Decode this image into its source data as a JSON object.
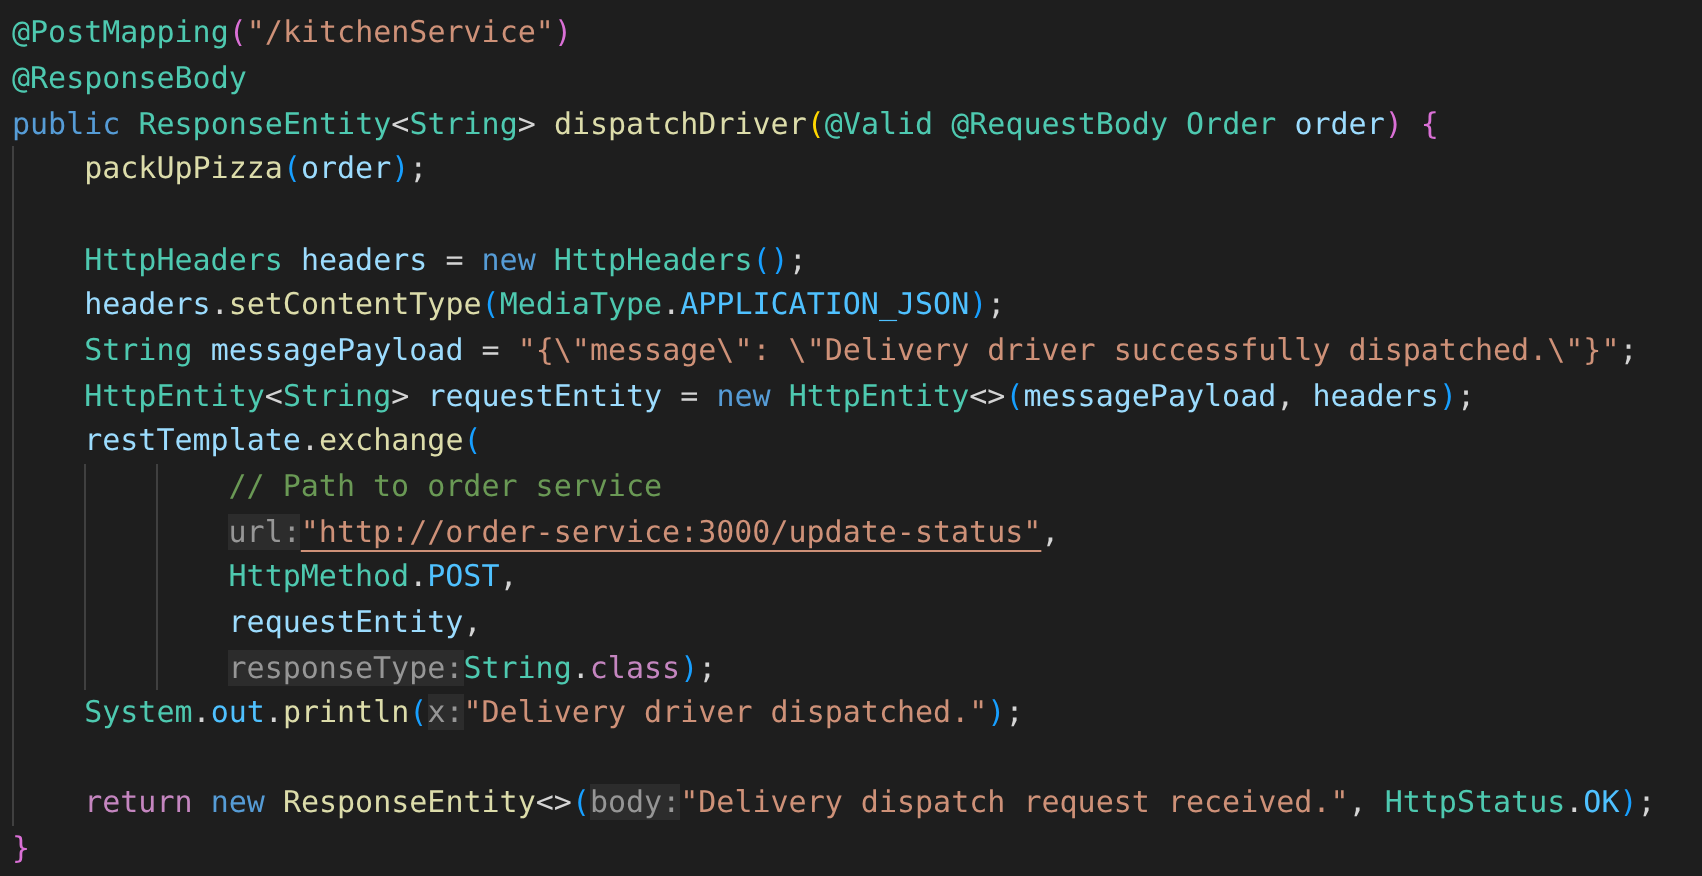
{
  "editor": {
    "lines": [
      {
        "tokens": [
          {
            "kind": "ann",
            "text": "@PostMapping"
          },
          {
            "kind": "b2",
            "text": "("
          },
          {
            "kind": "str",
            "text": "\"/kitchenService\""
          },
          {
            "kind": "b2",
            "text": ")"
          }
        ]
      },
      {
        "tokens": [
          {
            "kind": "ann",
            "text": "@ResponseBody"
          }
        ]
      },
      {
        "tokens": [
          {
            "kind": "kw",
            "text": "public "
          },
          {
            "kind": "type",
            "text": "ResponseEntity"
          },
          {
            "kind": "plain",
            "text": "<"
          },
          {
            "kind": "type",
            "text": "String"
          },
          {
            "kind": "plain",
            "text": "> "
          },
          {
            "kind": "fn",
            "text": "dispatchDriver"
          },
          {
            "kind": "b1",
            "text": "("
          },
          {
            "kind": "ann",
            "text": "@Valid @RequestBody Order "
          },
          {
            "kind": "var",
            "text": "order"
          },
          {
            "kind": "b2",
            "text": ")"
          },
          {
            "kind": "b2",
            "text": " {"
          }
        ],
        "children": [
          {
            "tokens": [
              {
                "kind": "fn",
                "text": "packUpPizza"
              },
              {
                "kind": "b3",
                "text": "("
              },
              {
                "kind": "var",
                "text": "order"
              },
              {
                "kind": "b3",
                "text": ")"
              },
              {
                "kind": "plain",
                "text": ";"
              }
            ]
          },
          {
            "kind": "blank"
          },
          {
            "tokens": [
              {
                "kind": "type",
                "text": "HttpHeaders "
              },
              {
                "kind": "var",
                "text": "headers"
              },
              {
                "kind": "plain",
                "text": " = "
              },
              {
                "kind": "kw",
                "text": "new "
              },
              {
                "kind": "type",
                "text": "HttpHeaders"
              },
              {
                "kind": "b3",
                "text": "()"
              },
              {
                "kind": "plain",
                "text": ";"
              }
            ]
          },
          {
            "tokens": [
              {
                "kind": "var",
                "text": "headers"
              },
              {
                "kind": "plain",
                "text": "."
              },
              {
                "kind": "fn",
                "text": "setContentType"
              },
              {
                "kind": "b3",
                "text": "("
              },
              {
                "kind": "type",
                "text": "MediaType"
              },
              {
                "kind": "plain",
                "text": "."
              },
              {
                "kind": "const",
                "text": "APPLICATION_JSON"
              },
              {
                "kind": "b3",
                "text": ")"
              },
              {
                "kind": "plain",
                "text": ";"
              }
            ]
          },
          {
            "tokens": [
              {
                "kind": "type",
                "text": "String "
              },
              {
                "kind": "var",
                "text": "messagePayload"
              },
              {
                "kind": "plain",
                "text": " = "
              },
              {
                "kind": "str",
                "text": "\"{\\\"message\\\": \\\"Delivery driver successfully dispatched.\\\"}\""
              },
              {
                "kind": "plain",
                "text": ";"
              }
            ]
          },
          {
            "tokens": [
              {
                "kind": "type",
                "text": "HttpEntity"
              },
              {
                "kind": "plain",
                "text": "<"
              },
              {
                "kind": "type",
                "text": "String"
              },
              {
                "kind": "plain",
                "text": "> "
              },
              {
                "kind": "var",
                "text": "requestEntity"
              },
              {
                "kind": "plain",
                "text": " = "
              },
              {
                "kind": "kw",
                "text": "new "
              },
              {
                "kind": "type",
                "text": "HttpEntity"
              },
              {
                "kind": "plain",
                "text": "<>"
              },
              {
                "kind": "b3",
                "text": "("
              },
              {
                "kind": "var",
                "text": "messagePayload"
              },
              {
                "kind": "plain",
                "text": ", "
              },
              {
                "kind": "var",
                "text": "headers"
              },
              {
                "kind": "b3",
                "text": ")"
              },
              {
                "kind": "plain",
                "text": ";"
              }
            ]
          },
          {
            "tokens": [
              {
                "kind": "var",
                "text": "restTemplate"
              },
              {
                "kind": "plain",
                "text": "."
              },
              {
                "kind": "fn",
                "text": "exchange"
              },
              {
                "kind": "b3",
                "text": "("
              }
            ],
            "hanging": true,
            "children": [
              {
                "tokens": [
                  {
                    "kind": "com",
                    "text": "// Path to order service"
                  }
                ]
              },
              {
                "tokens": [
                  {
                    "kind": "hint",
                    "text": "url:"
                  },
                  {
                    "kind": "url",
                    "text": "\"http://order-service:3000/update-status\""
                  },
                  {
                    "kind": "plain",
                    "text": ","
                  }
                ]
              },
              {
                "tokens": [
                  {
                    "kind": "type",
                    "text": "HttpMethod"
                  },
                  {
                    "kind": "plain",
                    "text": "."
                  },
                  {
                    "kind": "const",
                    "text": "POST"
                  },
                  {
                    "kind": "plain",
                    "text": ","
                  }
                ]
              },
              {
                "tokens": [
                  {
                    "kind": "var",
                    "text": "requestEntity"
                  },
                  {
                    "kind": "plain",
                    "text": ","
                  }
                ]
              },
              {
                "tokens": [
                  {
                    "kind": "hint",
                    "text": "responseType:"
                  },
                  {
                    "kind": "type",
                    "text": "String"
                  },
                  {
                    "kind": "plain",
                    "text": "."
                  },
                  {
                    "kind": "ctl",
                    "text": "class"
                  },
                  {
                    "kind": "b3",
                    "text": ")"
                  },
                  {
                    "kind": "plain",
                    "text": ";"
                  }
                ]
              }
            ]
          },
          {
            "tokens": [
              {
                "kind": "type",
                "text": "System"
              },
              {
                "kind": "plain",
                "text": "."
              },
              {
                "kind": "const",
                "text": "out"
              },
              {
                "kind": "plain",
                "text": "."
              },
              {
                "kind": "fn",
                "text": "println"
              },
              {
                "kind": "b3",
                "text": "("
              },
              {
                "kind": "hint",
                "text": "x:"
              },
              {
                "kind": "str",
                "text": "\"Delivery driver dispatched.\""
              },
              {
                "kind": "b3",
                "text": ")"
              },
              {
                "kind": "plain",
                "text": ";"
              }
            ]
          },
          {
            "kind": "blank"
          },
          {
            "tokens": [
              {
                "kind": "ctl",
                "text": "return "
              },
              {
                "kind": "kw",
                "text": "new "
              },
              {
                "kind": "fn",
                "text": "ResponseEntity"
              },
              {
                "kind": "plain",
                "text": "<>"
              },
              {
                "kind": "b3",
                "text": "("
              },
              {
                "kind": "hint",
                "text": "body:"
              },
              {
                "kind": "str",
                "text": "\"Delivery dispatch request received.\""
              },
              {
                "kind": "plain",
                "text": ", "
              },
              {
                "kind": "type",
                "text": "HttpStatus"
              },
              {
                "kind": "plain",
                "text": "."
              },
              {
                "kind": "const",
                "text": "OK"
              },
              {
                "kind": "b3",
                "text": ")"
              },
              {
                "kind": "plain",
                "text": ";"
              }
            ]
          }
        ]
      },
      {
        "tokens": [
          {
            "kind": "b2",
            "text": "}"
          }
        ]
      }
    ]
  }
}
